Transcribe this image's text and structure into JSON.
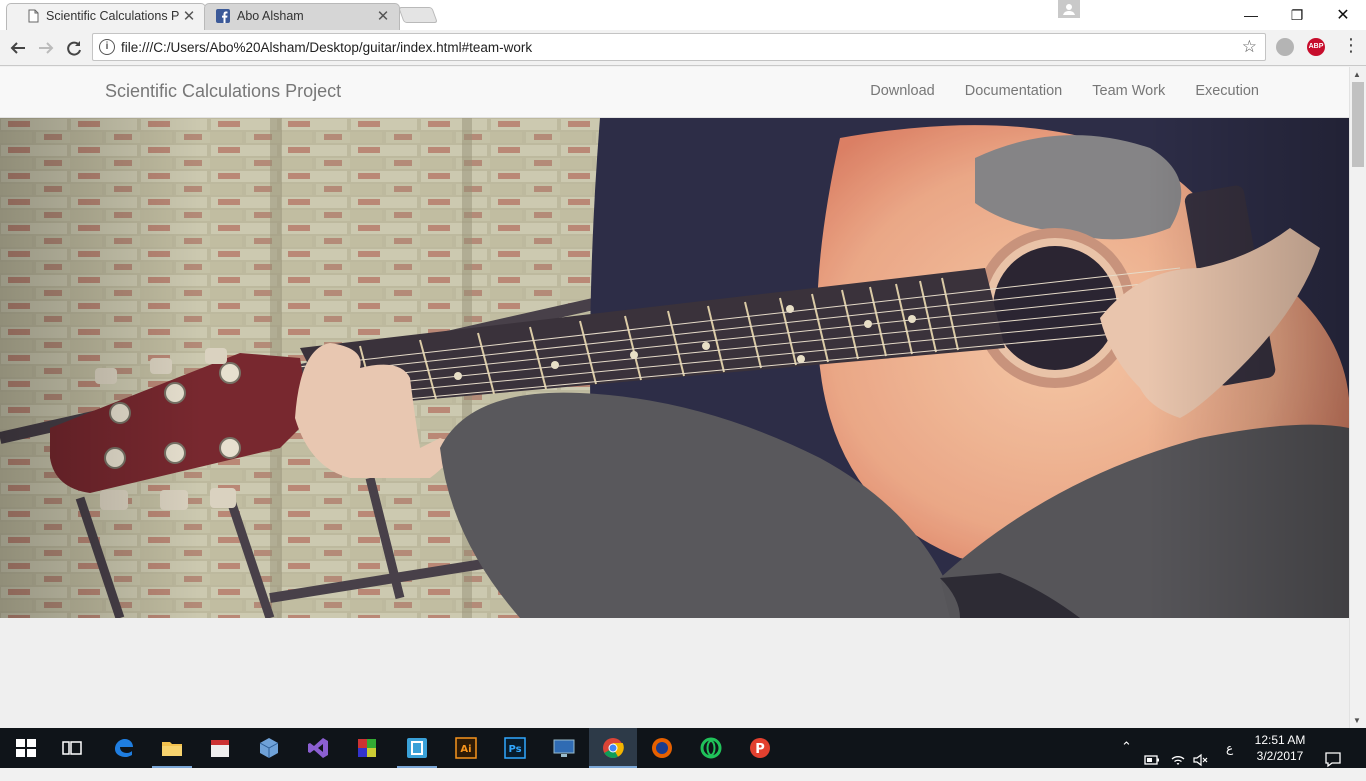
{
  "browser": {
    "tabs": [
      {
        "title": "Scientific Calculations Pro",
        "active": true,
        "close": "✕"
      },
      {
        "title": "Abo Alsham",
        "active": false,
        "close": "✕"
      }
    ],
    "url": "file:///C:/Users/Abo%20Alsham/Desktop/guitar/index.html#team-work",
    "extension_abp_label": "ABP",
    "window_controls": {
      "minimize": "—",
      "restore": "❐",
      "close": "✕"
    }
  },
  "site": {
    "brand": "Scientific Calculations Project",
    "nav": [
      "Download",
      "Documentation",
      "Team Work",
      "Execution"
    ]
  },
  "taskbar": {
    "time": "12:51 AM",
    "date": "3/2/2017",
    "lang": "ع",
    "apps": [
      "windows",
      "task-view",
      "edge",
      "file-explorer",
      "calendar",
      "virtualbox",
      "visual-studio",
      "winrar",
      "app-frame",
      "illustrator",
      "photoshop",
      "screen-capture",
      "chrome",
      "firefox",
      "opera",
      "psiphon"
    ]
  },
  "colors": {
    "accent_blue": "#1a73c8",
    "abp_red": "#c70d2c",
    "taskbar_bg": "#0f1419"
  }
}
